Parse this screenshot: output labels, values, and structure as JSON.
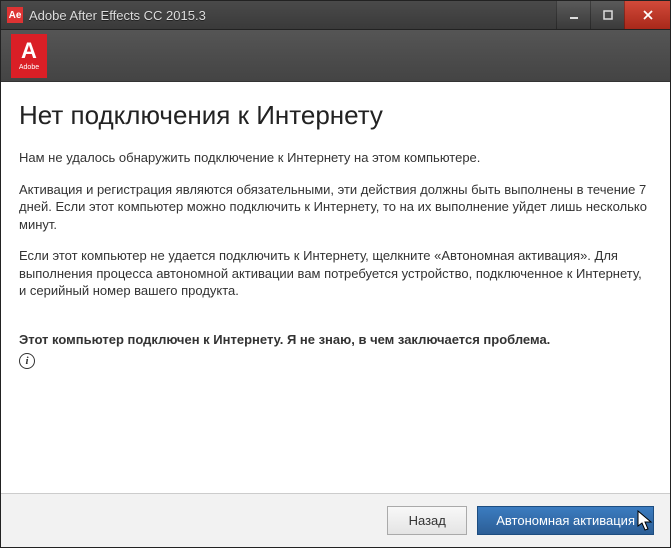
{
  "window": {
    "title": "Adobe After Effects CC 2015.3",
    "icon_text": "Ae"
  },
  "logo": {
    "letter": "A",
    "word": "Adobe"
  },
  "heading": "Нет подключения к Интернету",
  "paragraphs": [
    "Нам не удалось обнаружить подключение к Интернету на этом компьютере.",
    "Активация и регистрация являются обязательными, эти действия должны быть выполнены в течение 7 дней. Если этот компьютер можно подключить к Интернету, то на их выполнение уйдет лишь несколько минут.",
    "Если этот компьютер не удается подключить к Интернету, щелкните «Автономная активация». Для выполнения процесса автономной активации вам потребуется устройство, подключенное к Интернету, и серийный номер вашего продукта."
  ],
  "troubleshoot": "Этот компьютер подключен к Интернету. Я не знаю, в чем заключается проблема.",
  "buttons": {
    "back": "Назад",
    "offline": "Автономная активация"
  }
}
